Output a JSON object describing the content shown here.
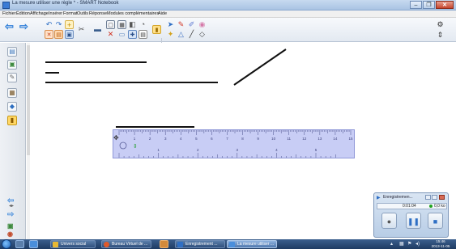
{
  "window": {
    "title": "La mesure utiliser une règle * - SMART Notebook",
    "buttons": [
      "minimize",
      "maximize",
      "close"
    ]
  },
  "menu": [
    "Fichier",
    "Édition",
    "Affichage",
    "Insérer",
    "Format",
    "Outils",
    "Réponse",
    "Modules complémentaires",
    "Aide"
  ],
  "toolbar": {
    "icons": [
      "back-arrow-icon",
      "forward-arrow-icon",
      "undo-icon",
      "redo-icon",
      "add-page-icon",
      "delete-page-icon",
      "open-file-icon",
      "save-icon",
      "paste-icon",
      "screen-shade-icon",
      "full-screen-icon",
      "delete-icon",
      "table-icon",
      "capture-icon",
      "document-camera-icon",
      "tools-icon",
      "select-pointer-icon",
      "pen-icon",
      "highlighter-icon",
      "eraser-icon",
      "magic-pen-icon",
      "shapes-icon",
      "line-icon",
      "fill-icon",
      "settings-gear-icon",
      "toolbar-move-icon"
    ]
  },
  "side_tabs": [
    "page-sorter-icon",
    "gallery-icon",
    "attachments-icon",
    "properties-icon",
    "addons-icon",
    "lock-icon"
  ],
  "side_arrows": [
    "back-arrow-icon",
    "forward-arrow-icon"
  ],
  "ruler": {
    "top_scale": [
      "1",
      "2",
      "3",
      "4",
      "5",
      "6",
      "7",
      "8",
      "9",
      "10",
      "11",
      "12",
      "13",
      "14",
      "15"
    ],
    "bottom_scale": [
      "1",
      "2",
      "3",
      "4",
      "5"
    ]
  },
  "recorder": {
    "title": "Enregistremen...",
    "time": "0:01:04",
    "size": "0,0 ko",
    "buttons": [
      "record-icon",
      "pause-icon",
      "stop-icon"
    ]
  },
  "taskbar": {
    "tasks": [
      {
        "label": "Univers social",
        "color": "#e8b933",
        "active": false
      },
      {
        "label": "Bureau Virtuel de ...",
        "color": "#e05a2b",
        "active": false
      },
      {
        "label": "Enregistrement ...",
        "color": "#2f6fc4",
        "active": false
      },
      {
        "label": "La mesure utiliser ...",
        "color": "#4a8fdc",
        "active": true
      }
    ],
    "time": "15:46",
    "date": "2013-11-05"
  },
  "colors": {
    "ruler": "#c8cdf5",
    "ruler_border": "#8f97d8",
    "line": "#111111",
    "taskbar": "#2a4a76"
  }
}
